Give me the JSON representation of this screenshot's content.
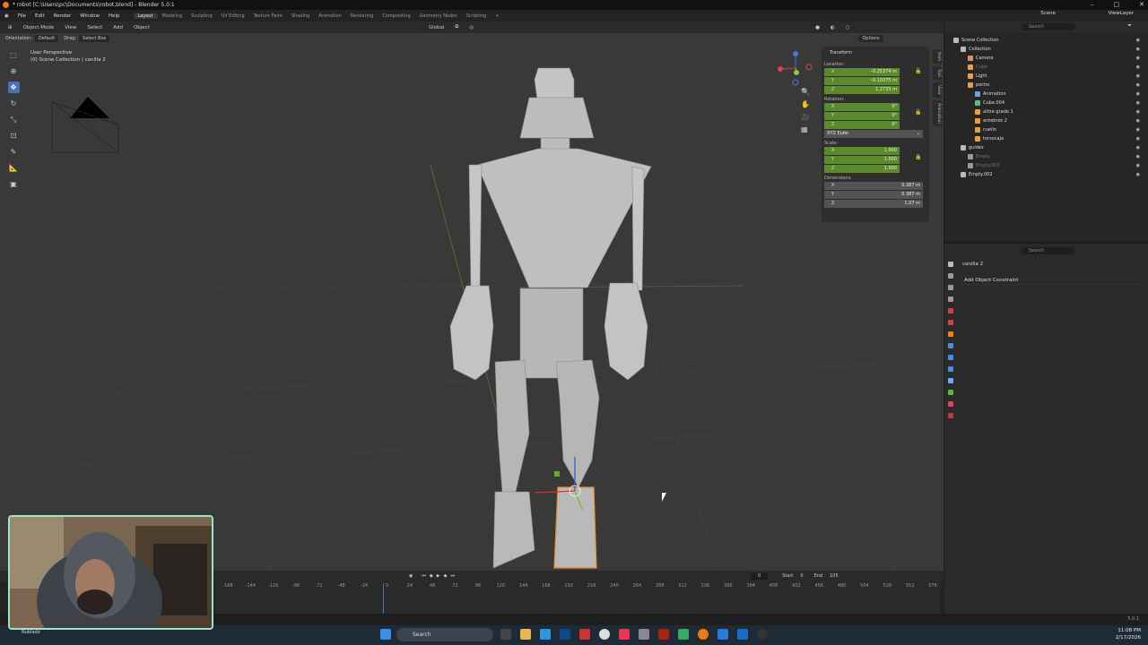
{
  "window": {
    "title": "* robot [C:\\Users\\pc\\Documents\\robot.blend] - Blender 5.0.1"
  },
  "menu": {
    "items": [
      "File",
      "Edit",
      "Render",
      "Window",
      "Help"
    ],
    "workspaces": [
      "Layout",
      "Modeling",
      "Sculpting",
      "UV Editing",
      "Texture Paint",
      "Shading",
      "Animation",
      "Rendering",
      "Compositing",
      "Geometry Nodes",
      "Scripting"
    ]
  },
  "scene": "Scene",
  "view_layer": "ViewLayer",
  "viewport": {
    "mode": "Object Mode",
    "menus": [
      "View",
      "Select",
      "Add",
      "Object"
    ],
    "orientation_label": "Orientation:",
    "orientation": "Default",
    "drag_label": "Drag:",
    "drag": "Select Box",
    "transform_orient": "Global",
    "options": "Options",
    "perspective": "User Perspective",
    "collection_info": "(0) Scene Collection | canilla 2"
  },
  "npanel": {
    "title": "Transform",
    "location_label": "Location:",
    "location": [
      {
        "k": "X",
        "v": "-0.25374 m"
      },
      {
        "k": "Y",
        "v": "-0.15075 m"
      },
      {
        "k": "Z",
        "v": "1.2733 m"
      }
    ],
    "rotation_label": "Rotation:",
    "rotation": [
      {
        "k": "X",
        "v": "0°"
      },
      {
        "k": "Y",
        "v": "0°"
      },
      {
        "k": "Z",
        "v": "0°"
      }
    ],
    "rotation_mode": "XYZ Euler",
    "scale_label": "Scale:",
    "scale": [
      {
        "k": "X",
        "v": "1.000"
      },
      {
        "k": "Y",
        "v": "1.000"
      },
      {
        "k": "Z",
        "v": "1.000"
      }
    ],
    "dimensions_label": "Dimensions:",
    "dimensions": [
      {
        "k": "X",
        "v": "0.387 m"
      },
      {
        "k": "Y",
        "v": "0.387 m"
      },
      {
        "k": "Z",
        "v": "1.07 m"
      }
    ],
    "tabs": [
      "Item",
      "Tool",
      "View",
      "Animation"
    ]
  },
  "outliner": {
    "search": "Search",
    "rows": [
      {
        "label": "Scene Collection",
        "indent": 0,
        "color": "#bbbbbb",
        "dim": false
      },
      {
        "label": "Collection",
        "indent": 1,
        "color": "#bbbbbb",
        "dim": false
      },
      {
        "label": "Camera",
        "indent": 2,
        "color": "#e28d5f",
        "dim": false
      },
      {
        "label": "Cube",
        "indent": 2,
        "color": "#e8a040",
        "dim": true
      },
      {
        "label": "Light",
        "indent": 2,
        "color": "#e8a040",
        "dim": false
      },
      {
        "label": "pecho",
        "indent": 2,
        "color": "#e8a040",
        "dim": false
      },
      {
        "label": "Animation",
        "indent": 3,
        "color": "#6fa0d8",
        "dim": false
      },
      {
        "label": "Cube.004",
        "indent": 3,
        "color": "#5fb88a",
        "dim": false
      },
      {
        "label": "altire grado 1",
        "indent": 3,
        "color": "#e8a040",
        "dim": false
      },
      {
        "label": "antebrzo 2",
        "indent": 3,
        "color": "#e8a040",
        "dim": false
      },
      {
        "label": "cuello",
        "indent": 3,
        "color": "#e8a040",
        "dim": false
      },
      {
        "label": "torsocaja",
        "indent": 3,
        "color": "#e8a040",
        "dim": false
      },
      {
        "label": "guides",
        "indent": 1,
        "color": "#bbbbbb",
        "dim": false
      },
      {
        "label": "Empty",
        "indent": 2,
        "color": "#999999",
        "dim": true
      },
      {
        "label": "Empty.003",
        "indent": 2,
        "color": "#999999",
        "dim": true
      },
      {
        "label": "Empty.002",
        "indent": 1,
        "color": "#bbbbbb",
        "dim": false
      }
    ]
  },
  "properties": {
    "search": "Search",
    "object": "canilla 2",
    "add_constraint": "Add Object Constraint"
  },
  "timeline": {
    "frame": "0",
    "start_label": "Start",
    "start": "0",
    "end_label": "End",
    "end": "105",
    "ticks": [
      "-168",
      "-144",
      "-120",
      "-96",
      "-72",
      "-48",
      "-24",
      "0",
      "24",
      "48",
      "72",
      "96",
      "120",
      "144",
      "168",
      "192",
      "216",
      "240",
      "264",
      "288",
      "312",
      "336",
      "360",
      "384",
      "408",
      "432",
      "456",
      "480",
      "504",
      "528",
      "552",
      "576"
    ]
  },
  "status": {
    "version": "5.0.1"
  },
  "taskbar": {
    "search": "Search",
    "time": "11:08 PM",
    "date": "2/17/2026",
    "weather": "Nublado"
  }
}
